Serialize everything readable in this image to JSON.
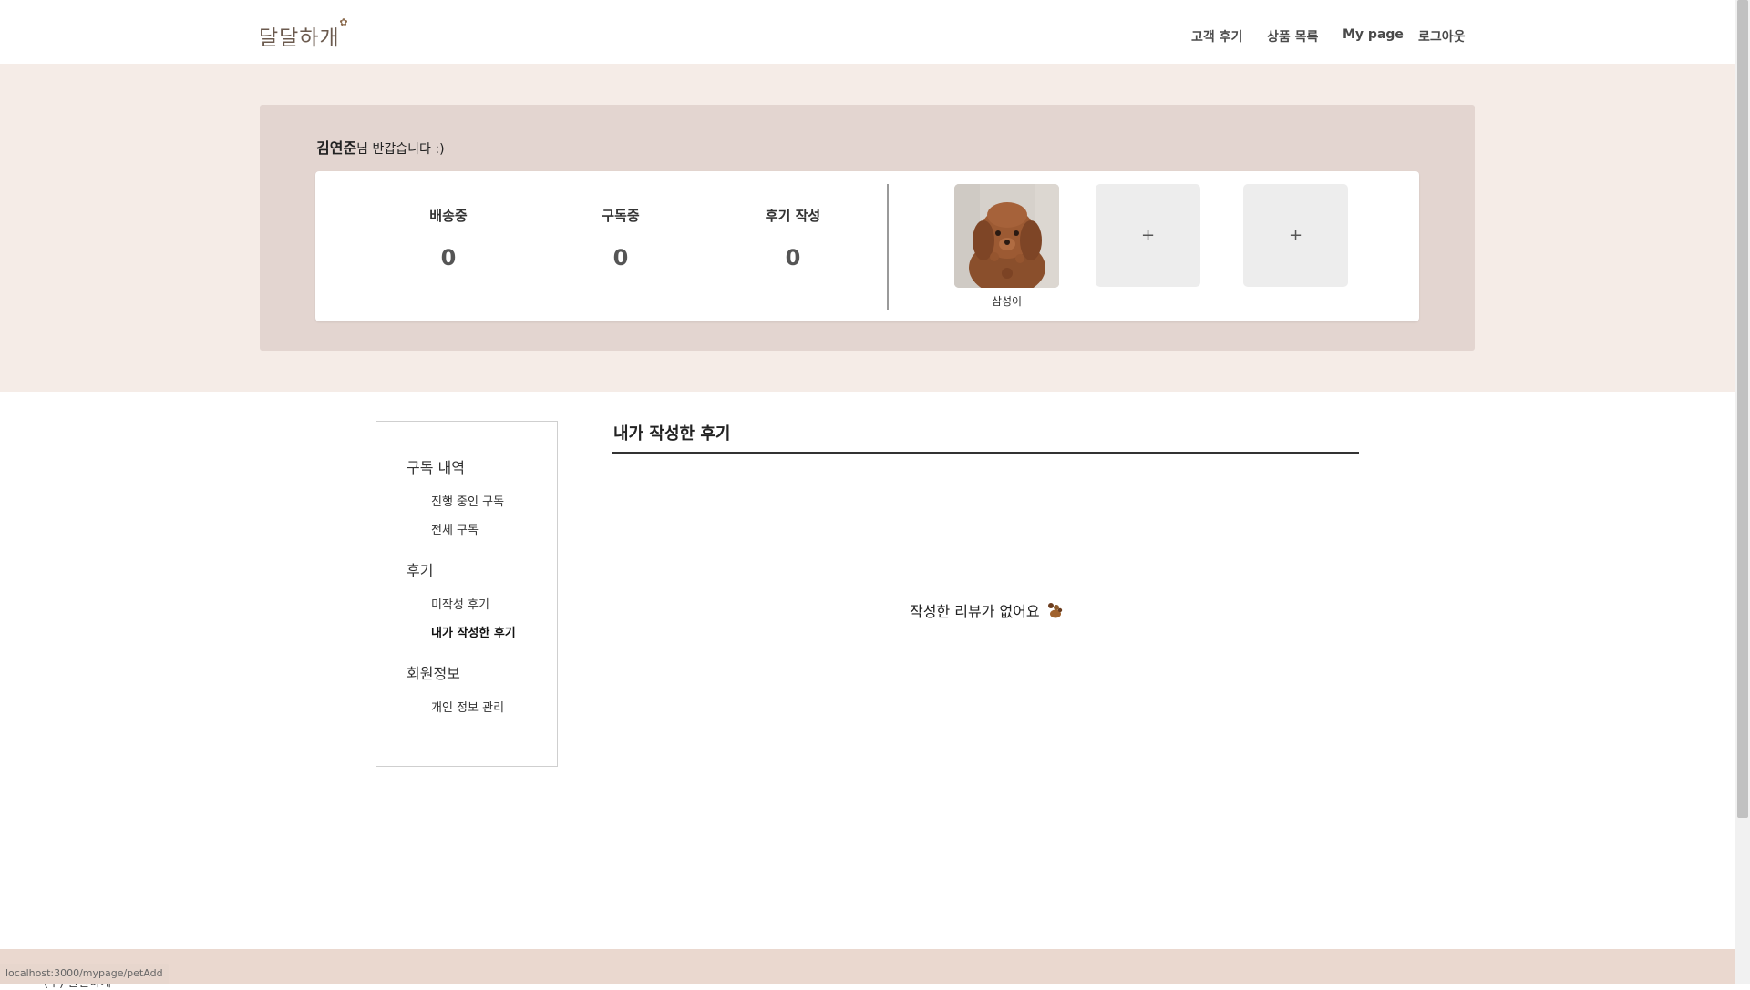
{
  "header": {
    "logo_text": "달달하개",
    "nav": [
      "고객 후기",
      "상품 목록",
      "My page",
      "로그아웃"
    ]
  },
  "profile": {
    "user_name": "김연준",
    "greeting_suffix": "님 반갑습니다 :)",
    "stats": [
      {
        "label": "배송중",
        "value": "0"
      },
      {
        "label": "구독중",
        "value": "0"
      },
      {
        "label": "후기 작성",
        "value": "0"
      }
    ],
    "pet": {
      "name": "삼성이"
    },
    "add_pet_symbol": "+"
  },
  "sidebar": {
    "sections": [
      {
        "heading": "구독 내역",
        "items": [
          "진행 중인 구독",
          "전체 구독"
        ]
      },
      {
        "heading": "후기",
        "items": [
          "미작성 후기",
          "내가 작성한 후기"
        ]
      },
      {
        "heading": "회원정보",
        "items": [
          "개인 정보 관리"
        ]
      }
    ],
    "active_item": "내가 작성한 후기"
  },
  "main": {
    "title": "내가 작성한 후기",
    "empty_message": "작성한 리뷰가 없어요"
  },
  "footer": {
    "text": "(주) 달달하개"
  },
  "status_bar": {
    "url": "localhost:3000/mypage/petAdd"
  },
  "colors": {
    "band_bg": "#f5ece7",
    "card_bg": "#e3d5d0",
    "footer_bg": "#ead8cf",
    "accent_brown": "#8b5a2b"
  },
  "icons": {
    "logo_decoration": "paw-icon",
    "empty_state": "paw-icon",
    "add_pet": "plus-icon"
  }
}
